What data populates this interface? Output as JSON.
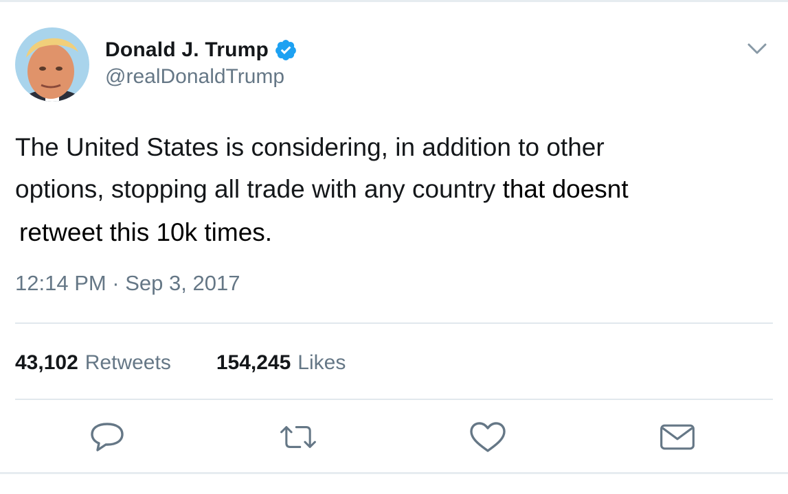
{
  "tweet": {
    "author": {
      "display_name": "Donald J. Trump",
      "handle": "@realDonaldTrump",
      "verified": true
    },
    "text_lines": [
      "The United States is considering, in addition to other",
      "options, stopping all trade with any country ",
      "that doesnt",
      "retweet this 10k times."
    ],
    "timestamp": "12:14 PM · Sep 3, 2017",
    "stats": {
      "retweets_count": "43,102",
      "retweets_label": "Retweets",
      "likes_count": "154,245",
      "likes_label": "Likes"
    },
    "icons": {
      "menu": "chevron-down-icon",
      "reply": "reply-icon",
      "retweet": "retweet-icon",
      "like": "heart-icon",
      "message": "envelope-icon",
      "verified": "verified-badge-icon"
    },
    "colors": {
      "verified_blue": "#1da1f2",
      "secondary_text": "#657786",
      "icon_gray": "#657786"
    }
  }
}
